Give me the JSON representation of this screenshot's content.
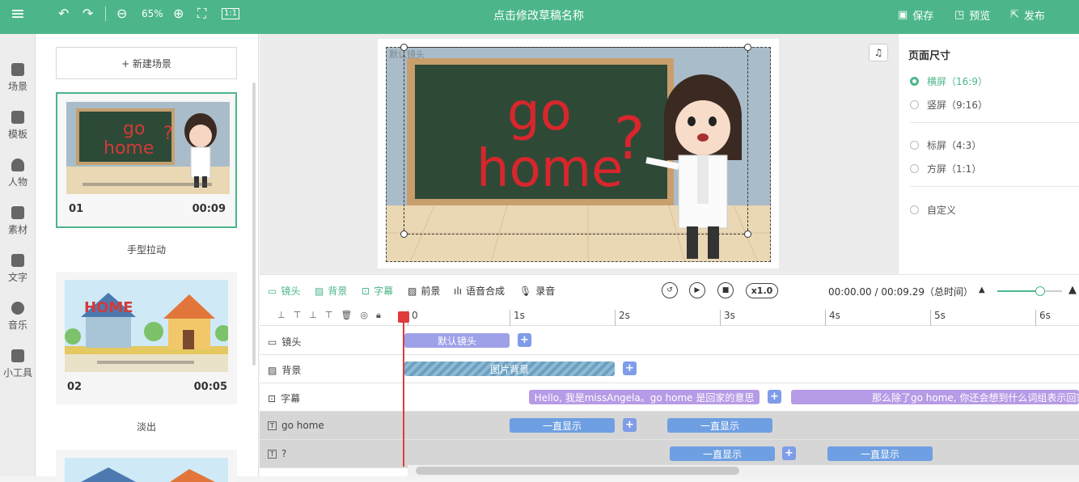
{
  "topbar": {
    "zoom": "65%",
    "title": "点击修改草稿名称",
    "save": "保存",
    "preview": "预览",
    "publish": "发布"
  },
  "leftnav": {
    "items": [
      {
        "label": "场景"
      },
      {
        "label": "模板"
      },
      {
        "label": "人物"
      },
      {
        "label": "素材"
      },
      {
        "label": "文字"
      },
      {
        "label": "音乐"
      },
      {
        "label": "小工具"
      }
    ]
  },
  "scenes": {
    "new_scene": "+ 新建场景",
    "list": [
      {
        "num": "01",
        "duration": "00:09",
        "label": "手型拉动",
        "thumb_text_1": "go",
        "thumb_text_2": "home",
        "thumb_text_3": "?"
      },
      {
        "num": "02",
        "duration": "00:05",
        "label": "淡出",
        "thumb_text_1": "HOME"
      }
    ]
  },
  "stage": {
    "board_text_1": "go",
    "board_text_2": "home",
    "board_text_3": "?",
    "stage_label": "默认镜头"
  },
  "page_size": {
    "title": "页面尺寸",
    "options": [
      {
        "label": "横屏（16:9）",
        "selected": true
      },
      {
        "label": "竖屏（9:16）",
        "selected": false
      },
      {
        "label": "标屏（4:3）",
        "selected": false
      },
      {
        "label": "方屏（1:1）",
        "selected": false
      },
      {
        "label": "自定义",
        "selected": false
      }
    ]
  },
  "toolbar": {
    "tabs": [
      "镜头",
      "背景",
      "字幕",
      "前景",
      "语音合成",
      "录音"
    ],
    "speed": "x1.0",
    "time": "00:00.00 / 00:09.29（总时间）"
  },
  "timeline": {
    "ruler": [
      "0",
      "1s",
      "2s",
      "3s",
      "4s",
      "5s",
      "6s"
    ],
    "tracks": [
      {
        "name": "镜头",
        "clips": [
          "默认镜头"
        ]
      },
      {
        "name": "背景",
        "clips": [
          "图片背景"
        ]
      },
      {
        "name": "字幕",
        "clips": [
          "Hello, 我是missAngela。go home 是回家的意思",
          "那么除了go home, 你还会想到什么词组表示回家"
        ]
      },
      {
        "name": "go home",
        "clips": [
          "一直显示",
          "一直显示"
        ]
      },
      {
        "name": "?",
        "clips": [
          "一直显示",
          "一直显示"
        ]
      }
    ]
  },
  "colors": {
    "brand": "#4cb68a",
    "playhead": "#e03a3a"
  }
}
